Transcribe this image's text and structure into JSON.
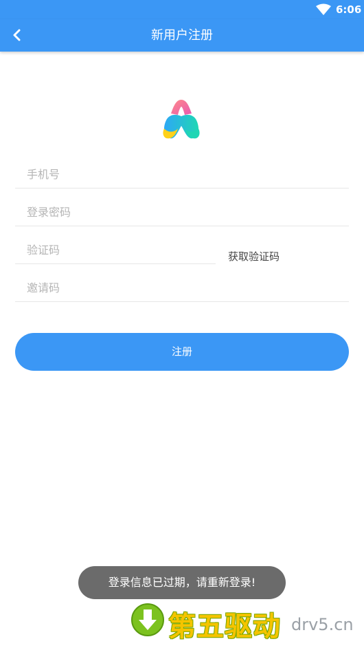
{
  "status_bar": {
    "time": "6:06",
    "wifi_icon": "wifi-icon"
  },
  "app_bar": {
    "title": "新用户注册",
    "back_icon": "chevron-left-icon"
  },
  "logo": {
    "icon": "app-logo-icon",
    "colors": [
      "#f46a9b",
      "#2ea8f5",
      "#1fd6b4",
      "#ffd11a"
    ]
  },
  "form": {
    "phone_placeholder": "手机号",
    "password_placeholder": "登录密码",
    "code_placeholder": "验证码",
    "get_code_label": "获取验证码",
    "invite_placeholder": "邀请码",
    "submit_label": "注册"
  },
  "toast": {
    "message": "登录信息已过期，请重新登录!"
  },
  "watermark": {
    "cn_text": "第五驱动",
    "en_text": "drv5.cn",
    "icon": "download-arrow-icon"
  },
  "colors": {
    "primary": "#3b97f5",
    "toast_bg": "#6b6b6b"
  }
}
